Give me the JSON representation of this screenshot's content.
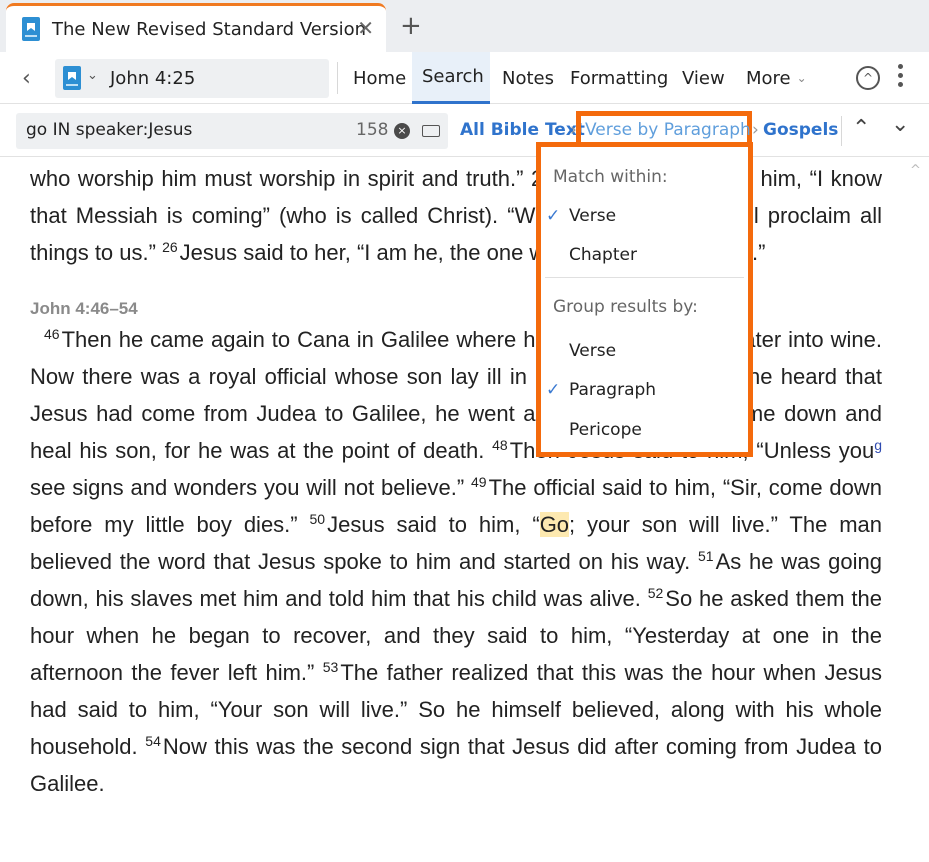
{
  "tab": {
    "title": "The New Revised Standard Version",
    "close": "✕",
    "new_tab": "+"
  },
  "toolbar": {
    "back": "‹",
    "reference": "John 4:25",
    "caret": "⌄",
    "menus": [
      "Home",
      "Search",
      "Notes",
      "Formatting",
      "View",
      "More"
    ],
    "more_caret": "⌄",
    "scroll_up_icon": "^"
  },
  "search": {
    "query": "go IN speaker:Jesus",
    "count": "158",
    "clear": "×",
    "scope": "All Bible Text",
    "sep": "›",
    "mode": "Verse by Paragraph",
    "range": "Gospels",
    "prev": "⌃",
    "next": "⌄"
  },
  "dropdown": {
    "match_header": "Match within:",
    "match_items": [
      "Verse",
      "Chapter"
    ],
    "match_selected": "Verse",
    "group_header": "Group results by:",
    "group_items": [
      "Verse",
      "Paragraph",
      "Pericope"
    ],
    "group_selected": "Paragraph",
    "check": "✓"
  },
  "passage": {
    "p1_text": "who worship him must worship in spirit and truth.” 25 The woman said to him, “I know that Messiah is coming” (who is called Christ). “When he comes, he will proclaim all things to us.”",
    "p1_v26": "26",
    "p1_rest": "Jesus said to her, “I am he, the one who is speaking to you.”",
    "heading": "John 4:46–54",
    "v46": "46",
    "t46": "Then he came again to Cana in Galilee where he had changed the water into wine. Now there was a royal official whose son lay ill in Capernaum.",
    "v47": "47",
    "t47": "When he heard that Jesus had come from Judea to Galilee, he went and begged him to come down and heal his son, for he was at the point of death.",
    "v48": "48",
    "t48a": "Then Jesus said to him, “Unless you",
    "fn_g": "g",
    "t48b": "see signs and wonders you will not believe.”",
    "v49": "49",
    "t49": "The official said to him, “Sir, come down before my little boy dies.”",
    "v50": "50",
    "t50a": "Jesus said to him, “",
    "t50_hl": "Go",
    "t50b": "; your son will live.” The man believed the word that Jesus spoke to him and started on his way.",
    "v51": "51",
    "t51": "As he was going down, his slaves met him and told him that his child was alive.",
    "v52": "52",
    "t52": "So he asked them the hour when he began to recover, and they said to him, “Yesterday at one in the afternoon the fever left him.”",
    "v53": "53",
    "t53": "The father realized that this was the hour when Jesus had said to him, “Your son will live.” So he himself believed, along with his whole household.",
    "v54": "54",
    "t54": "Now this was the second sign that Jesus did after coming from Judea to Galilee."
  }
}
